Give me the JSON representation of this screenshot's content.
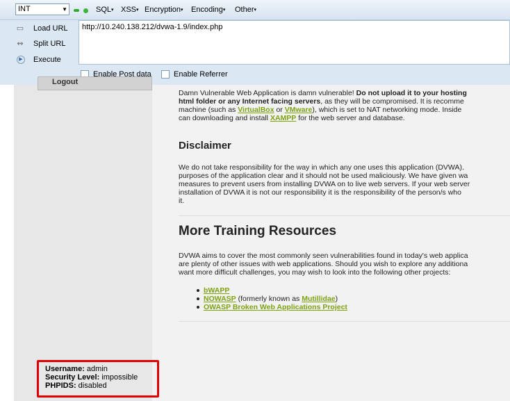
{
  "hackbar": {
    "select_value": "INT",
    "menus": [
      "SQL",
      "XSS",
      "Encryption",
      "Encoding",
      "Other"
    ],
    "buttons": {
      "load": "Load URL",
      "split": "Split URL",
      "execute": "Execute"
    },
    "url": "http://10.240.138.212/dvwa-1.9/index.php",
    "checkboxes": {
      "post": "Enable Post data",
      "referrer": "Enable Referrer"
    },
    "colors": {
      "dot_green": "#2eaa2e",
      "dot_lightgreen": "#7ad17a"
    }
  },
  "sidebar": {
    "logout": "Logout"
  },
  "content": {
    "intro": {
      "line1a": "Damn Vulnerable Web Application is damn vulnerable! ",
      "line1b": "Do not upload it to your hosting",
      "line2a": "html folder or any Internet facing servers",
      "line2b": ", as they will be compromised. It is recomme",
      "line3a": "machine (such as ",
      "virtualbox": "VirtualBox",
      "or": " or ",
      "vmware": "VMware",
      "line3b": "), which is set to NAT networking mode. Inside",
      "line4a": "can downloading and install ",
      "xampp": "XAMPP",
      "line4b": " for the web server and database."
    },
    "disclaimer_title": "Disclaimer",
    "disclaimer_lines": [
      "We do not take responsibility for the way in which any one uses this application (DVWA).",
      "purposes of the application clear and it should not be used maliciously. We have given wa",
      "measures to prevent users from installing DVWA on to live web servers. If your web server",
      "installation of DVWA it is not our responsibility it is the responsibility of the person/s who",
      "it."
    ],
    "training_title": "More Training Resources",
    "training_lines": [
      "DVWA aims to cover the most commonly seen vulnerabilities found in today's web applica",
      "are plenty of other issues with web applications. Should you wish to explore any additiona",
      "want more difficult challenges, you may wish to look into the following other projects:"
    ],
    "projects": {
      "bwapp": "bWAPP",
      "nowasp": "NOWASP",
      "nowasp_note_a": " (formerly known as ",
      "mutillidae": "Mutillidae",
      "nowasp_note_b": ")",
      "owasp": "OWASP Broken Web Applications Project"
    }
  },
  "status": {
    "username_label": "Username:",
    "username_value": " admin",
    "security_label": "Security Level:",
    "security_value": " impossible",
    "phpids_label": "PHPIDS:",
    "phpids_value": " disabled"
  }
}
